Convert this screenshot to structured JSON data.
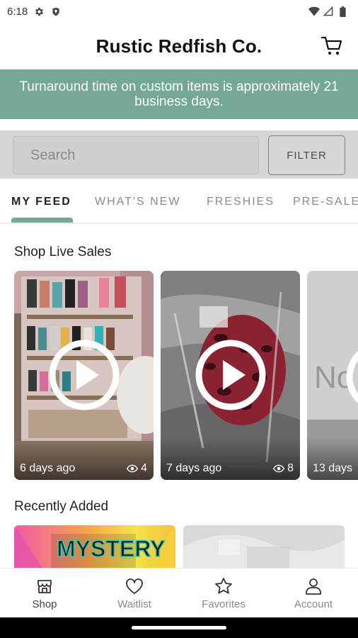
{
  "status_bar": {
    "time": "6:18"
  },
  "app_bar": {
    "title": "Rustic Redfish Co."
  },
  "banner": {
    "text": "Turnaround time on custom items is approximately 21 business days."
  },
  "search": {
    "placeholder": "Search",
    "filter_label": "FILTER"
  },
  "tabs": [
    {
      "label": "MY FEED",
      "active": true
    },
    {
      "label": "WHAT'S NEW",
      "active": false
    },
    {
      "label": "FRESHIES",
      "active": false
    },
    {
      "label": "PRE-SALE",
      "active": false
    }
  ],
  "live_sales": {
    "title": "Shop Live Sales",
    "cards": [
      {
        "time": "6 days ago",
        "views": "4"
      },
      {
        "time": "7 days ago",
        "views": "8"
      },
      {
        "time": "13 days",
        "views": ""
      }
    ]
  },
  "recently_added": {
    "title": "Recently Added",
    "items": [
      {
        "image_text": "MYSTERY"
      },
      {
        "image_text": ""
      }
    ]
  },
  "bottom_nav": [
    {
      "label": "Shop",
      "icon": "shop-icon",
      "active": true
    },
    {
      "label": "Waitlist",
      "icon": "heart-icon",
      "active": false
    },
    {
      "label": "Favorites",
      "icon": "star-icon",
      "active": false
    },
    {
      "label": "Account",
      "icon": "account-icon",
      "active": false
    }
  ],
  "colors": {
    "accent": "#74a893",
    "search_bg": "#d6d6d6"
  }
}
